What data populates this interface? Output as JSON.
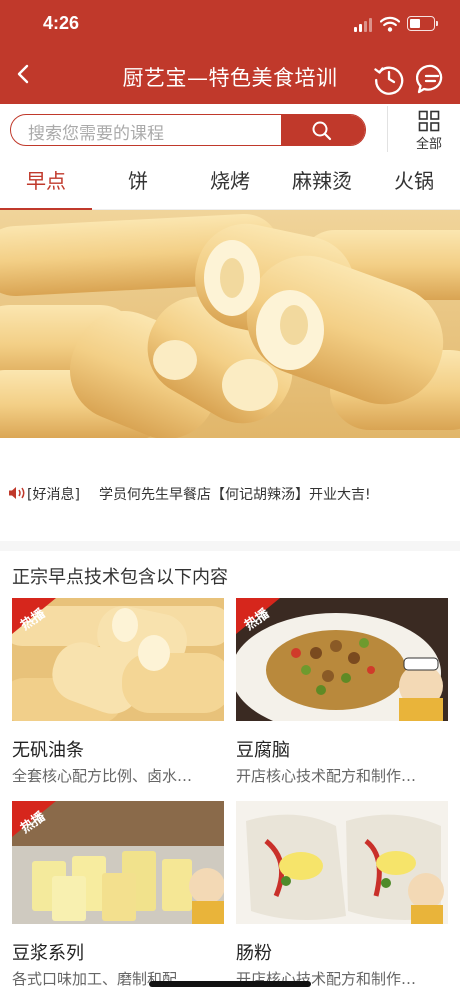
{
  "status": {
    "time": "4:26"
  },
  "nav": {
    "title": "厨艺宝—特色美食培训"
  },
  "search": {
    "placeholder": "搜索您需要的课程",
    "all_label": "全部"
  },
  "tabs": [
    {
      "label": "早点",
      "active": true
    },
    {
      "label": "饼",
      "active": false
    },
    {
      "label": "烧烤",
      "active": false
    },
    {
      "label": "麻辣烫",
      "active": false
    },
    {
      "label": "火锅",
      "active": false
    }
  ],
  "news": {
    "tag": "[好消息]",
    "text": "学员何先生早餐店【何记胡辣汤】开业大吉!"
  },
  "section": {
    "title": "正宗早点技术包含以下内容",
    "cards": [
      {
        "badge": "热播",
        "name": "无矾油条",
        "desc": "全套核心配方比例、卤水…"
      },
      {
        "badge": "热播",
        "name": "豆腐脑",
        "desc": "开店核心技术配方和制作…"
      },
      {
        "badge": "热播",
        "name": "豆浆系列",
        "desc": "各式口味加工、磨制和配…"
      },
      {
        "badge": "",
        "name": "肠粉",
        "desc": "开店核心技术配方和制作…"
      }
    ]
  },
  "colors": {
    "brand": "#c0392b",
    "text": "#333333",
    "muted": "#666666"
  }
}
